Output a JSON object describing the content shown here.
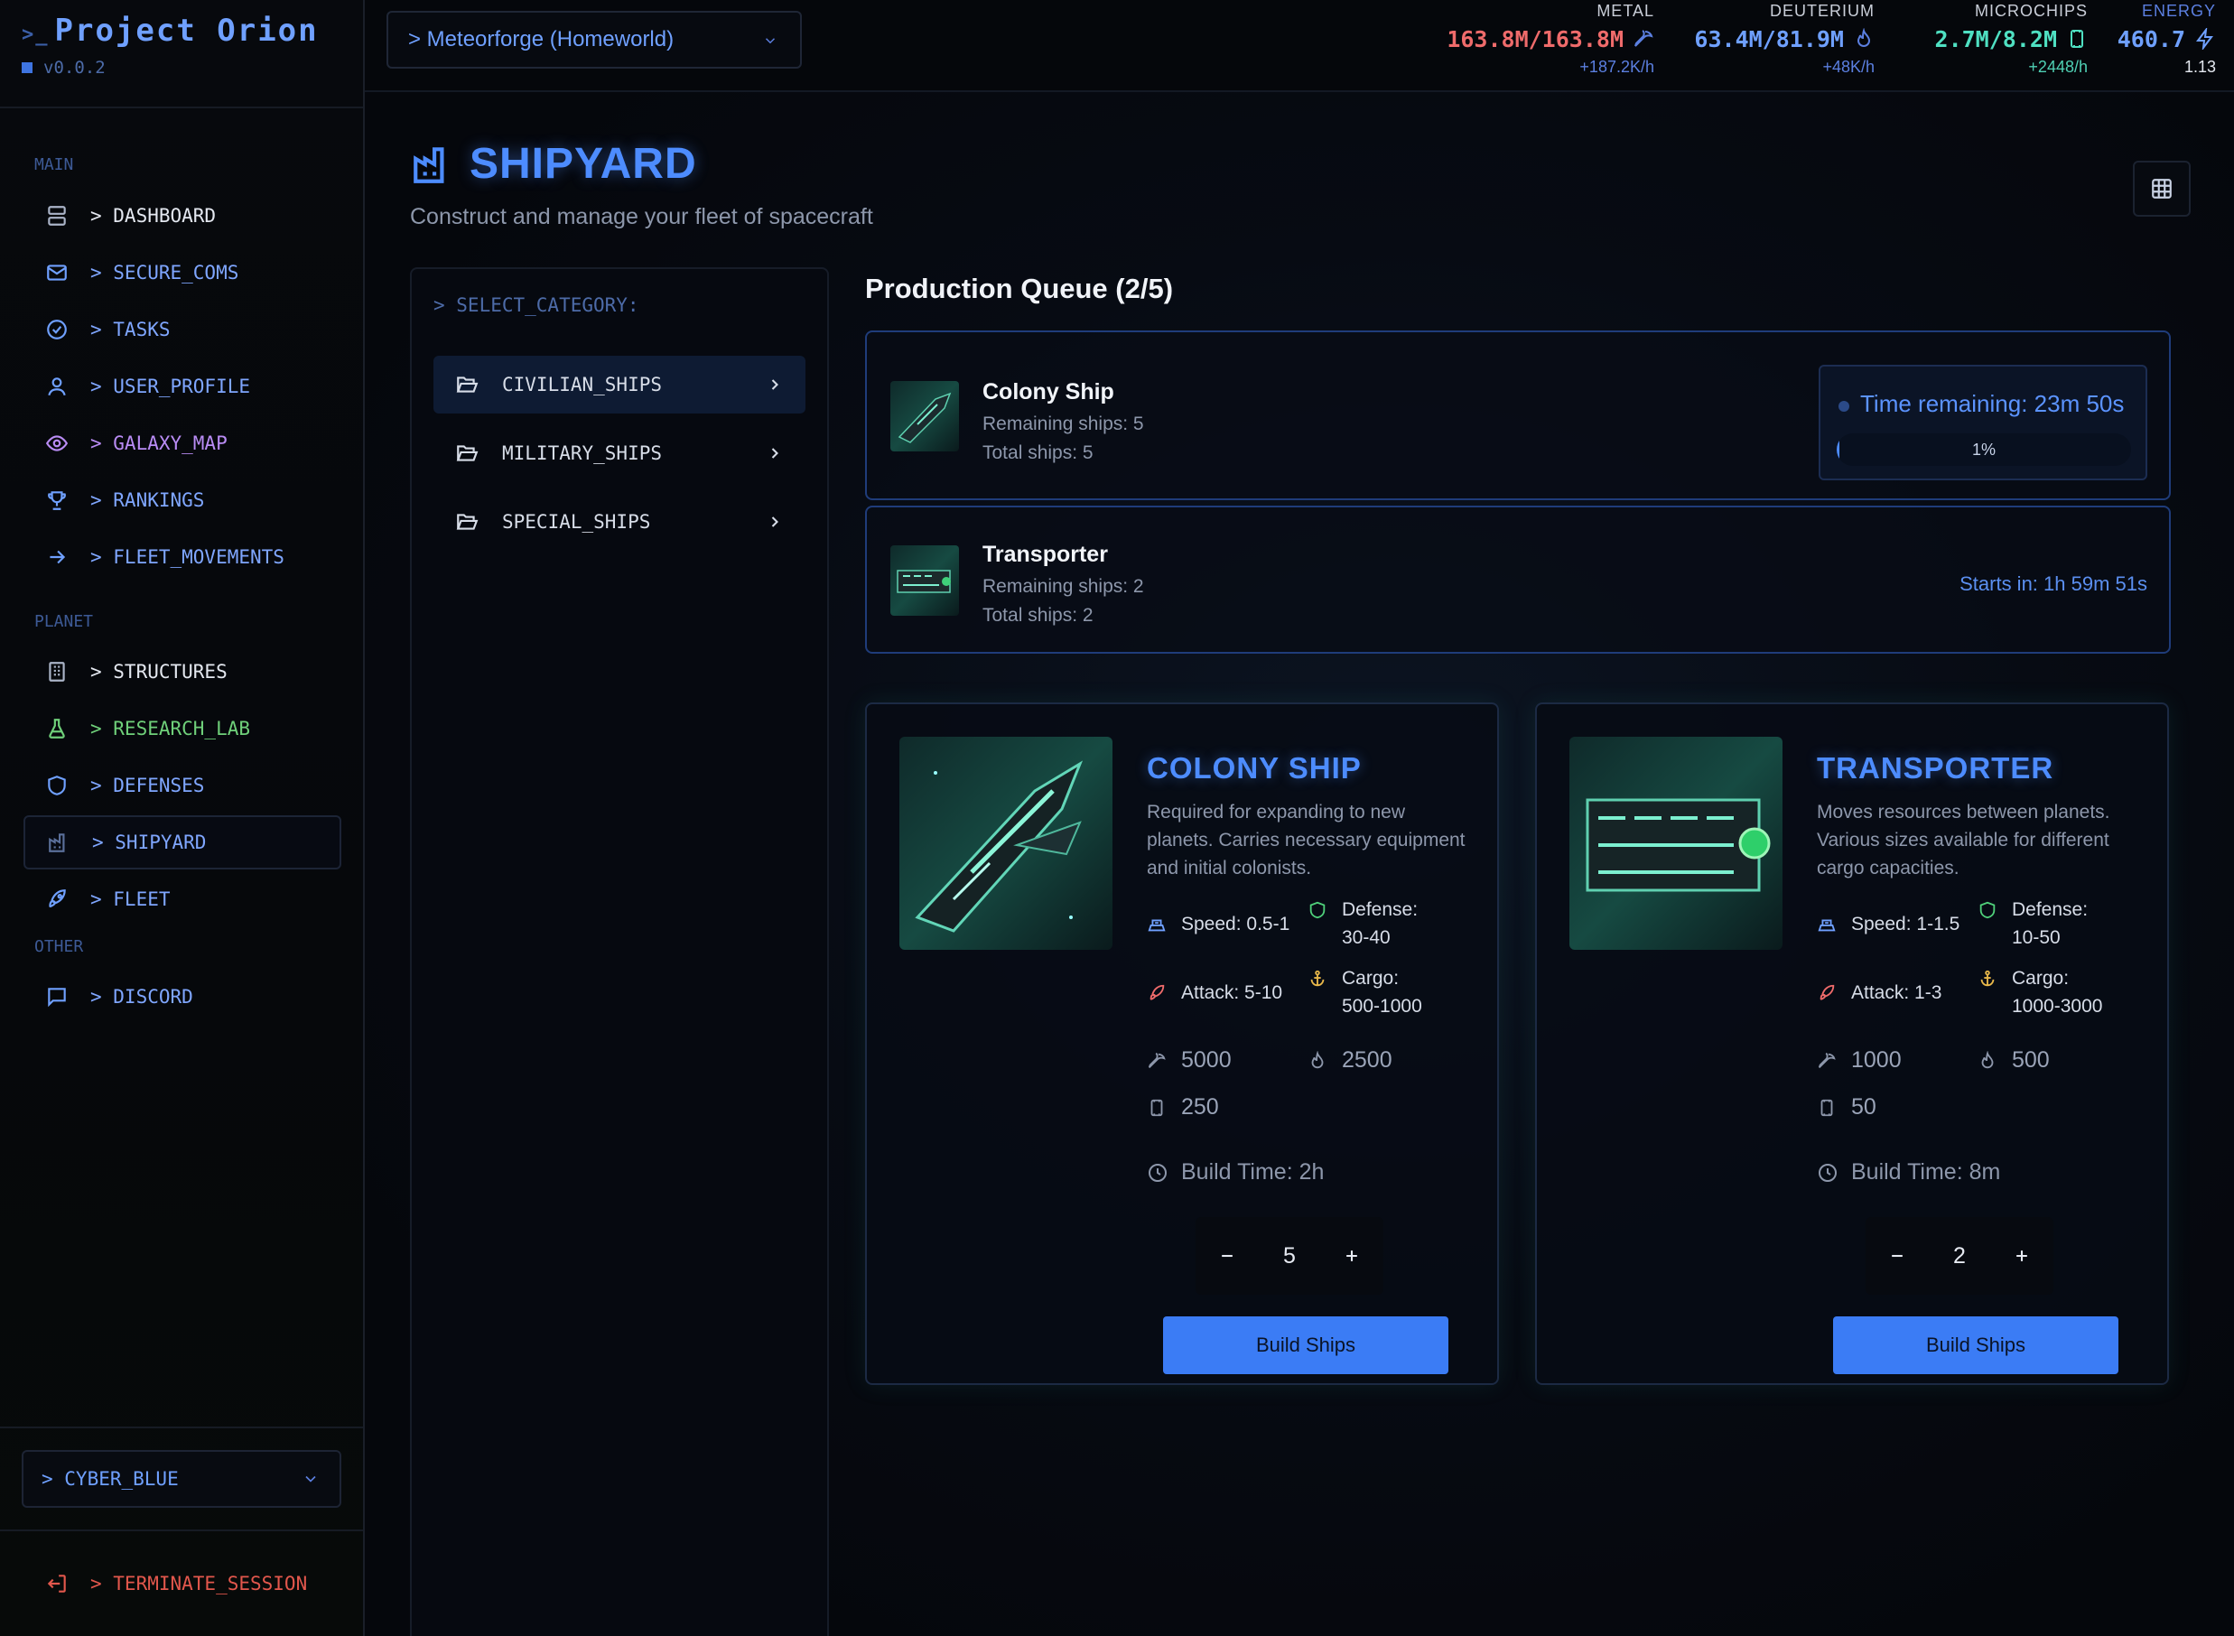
{
  "app": {
    "prefix": ">_",
    "title": "Project Orion",
    "version": "v0.0.2"
  },
  "nav": {
    "sections": {
      "main": "MAIN",
      "planet": "PLANET",
      "other": "OTHER"
    },
    "items": [
      {
        "label": "> DASHBOARD",
        "icon": "server-icon",
        "color": "#e4e8f0"
      },
      {
        "label": "> SECURE_COMS",
        "icon": "mail-icon",
        "color": "#7fa6ff"
      },
      {
        "label": "> TASKS",
        "icon": "check-circle-icon",
        "color": "#7fa6ff"
      },
      {
        "label": "> USER_PROFILE",
        "icon": "user-icon",
        "color": "#7fa6ff"
      },
      {
        "label": "> GALAXY_MAP",
        "icon": "eye-icon",
        "color": "#b98cf5"
      },
      {
        "label": "> RANKINGS",
        "icon": "trophy-icon",
        "color": "#7fa6ff"
      },
      {
        "label": "> FLEET_MOVEMENTS",
        "icon": "arrow-right-icon",
        "color": "#7fa6ff"
      },
      {
        "label": "> STRUCTURES",
        "icon": "building-icon",
        "color": "#e4e8f0"
      },
      {
        "label": "> RESEARCH_LAB",
        "icon": "flask-icon",
        "color": "#6fd07a"
      },
      {
        "label": "> DEFENSES",
        "icon": "shield-icon",
        "color": "#7fa6ff"
      },
      {
        "label": "> SHIPYARD",
        "icon": "factory-icon",
        "color": "#7fa6ff"
      },
      {
        "label": "> FLEET",
        "icon": "rocket-icon",
        "color": "#7fa6ff"
      },
      {
        "label": "> DISCORD",
        "icon": "chat-icon",
        "color": "#7fa6ff"
      }
    ],
    "theme": "> CYBER_BLUE",
    "logout": "> TERMINATE_SESSION"
  },
  "topbar": {
    "planet": "> Meteorforge (Homeworld)",
    "resources": [
      {
        "label": "METAL",
        "value": "163.8M/163.8M",
        "rate": "+187.2K/h",
        "color": "#ef6b6b",
        "rate_color": "#5b7fe0",
        "icon": "pickaxe-icon"
      },
      {
        "label": "DEUTERIUM",
        "value": "63.4M/81.9M",
        "rate": "+48K/h",
        "color": "#6fa0ff",
        "rate_color": "#5b7fe0",
        "icon": "flame-icon"
      },
      {
        "label": "MICROCHIPS",
        "value": "2.7M/8.2M",
        "rate": "+2448/h",
        "color": "#4fe0c2",
        "rate_color": "#4fd0b4",
        "icon": "chip-icon"
      },
      {
        "label": "ENERGY",
        "value": "460.7",
        "rate": "1.13",
        "color": "#6fa0ff",
        "rate_color": "#e4e8f0",
        "icon": "bolt-icon"
      }
    ]
  },
  "page": {
    "title": "SHIPYARD",
    "subtitle": "Construct and manage your fleet of spacecraft"
  },
  "categories": {
    "heading": "> SELECT_CATEGORY:",
    "items": [
      "CIVILIAN_SHIPS",
      "MILITARY_SHIPS",
      "SPECIAL_SHIPS"
    ],
    "selected": "CIVILIAN_SHIPS"
  },
  "queue": {
    "title": "Production Queue (2/5)",
    "items": [
      {
        "name": "Colony Ship",
        "remaining": "Remaining ships: 5",
        "total": "Total ships: 5",
        "time": "Time remaining: 23m 50s",
        "progress_label": "1%",
        "progress": 0.01
      },
      {
        "name": "Transporter",
        "remaining": "Remaining ships: 2",
        "total": "Total ships: 2",
        "starts": "Starts in: 1h 59m 51s"
      }
    ]
  },
  "ships": [
    {
      "name": "COLONY SHIP",
      "description": "Required for expanding to new planets. Carries necessary equipment and initial colonists.",
      "speed": "Speed: 0.5-1",
      "defense": "Defense: 30-40",
      "attack": "Attack: 5-10",
      "cargo": "Cargo: 500-1000",
      "cost_metal": "5000",
      "cost_deuterium": "2500",
      "cost_microchips": "250",
      "build_time": "Build Time: 2h",
      "quantity": "5",
      "build_label": "Build Ships"
    },
    {
      "name": "TRANSPORTER",
      "description": "Moves resources between planets. Various sizes available for different cargo capacities.",
      "speed": "Speed: 1-1.5",
      "defense": "Defense: 10-50",
      "attack": "Attack: 1-3",
      "cargo": "Cargo: 1000-3000",
      "cost_metal": "1000",
      "cost_deuterium": "500",
      "cost_microchips": "50",
      "build_time": "Build Time: 8m",
      "quantity": "2",
      "build_label": "Build Ships"
    }
  ]
}
